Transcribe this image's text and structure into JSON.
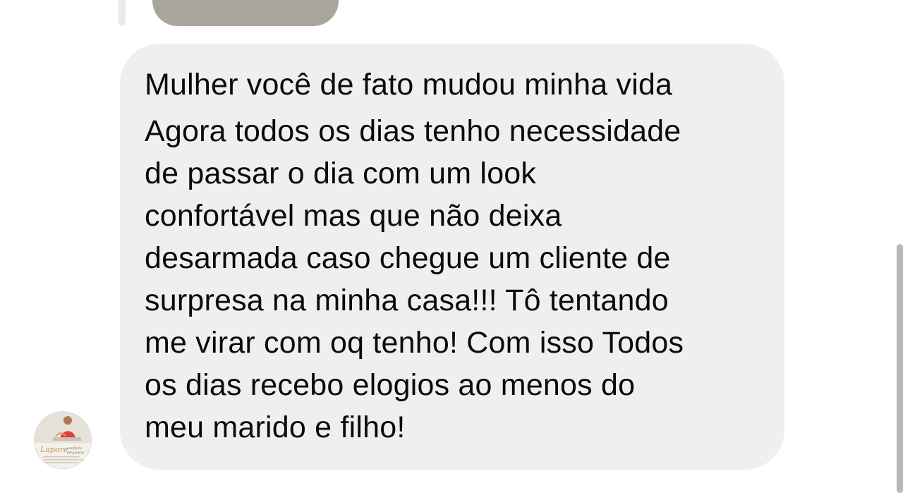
{
  "message": {
    "lines": [
      "Mulher você de fato mudou minha vida",
      "Agora todos os dias tenho necessidade",
      "de passar o dia com um look",
      "confortável mas que não deixa",
      "desarmada caso chegue um cliente de",
      "surpresa na minha casa!!! Tô tentando",
      "me virar com oq tenho! Com isso Todos",
      "os dias recebo elogios ao menos do",
      "meu marido e filho!"
    ]
  },
  "avatar": {
    "icon": "profile-photo"
  },
  "colors": {
    "bubble": "#efefef",
    "text": "#0b0b0b",
    "quoted_media": "#a9a59c",
    "scrollbar": "#b9b9b9"
  }
}
